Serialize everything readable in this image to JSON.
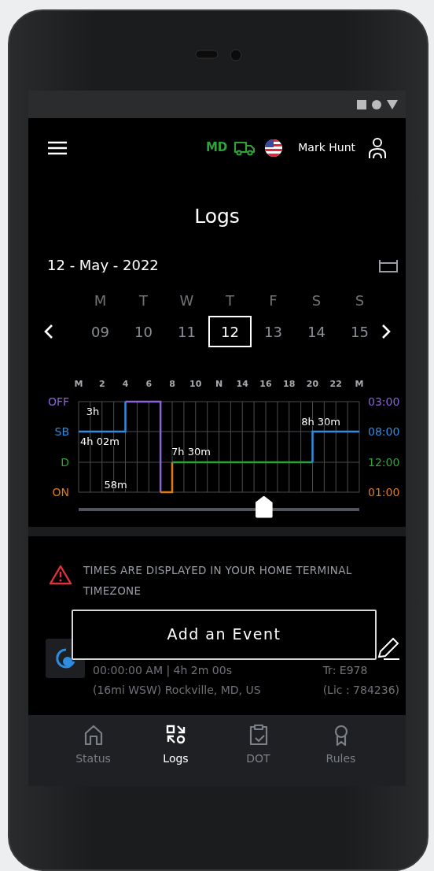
{
  "header": {
    "state": "MD",
    "user": "Mark Hunt"
  },
  "title": "Logs",
  "date": "12 - May - 2022",
  "week": [
    {
      "weekday": "M",
      "day": "09",
      "selected": false
    },
    {
      "weekday": "T",
      "day": "10",
      "selected": false
    },
    {
      "weekday": "W",
      "day": "11",
      "selected": false
    },
    {
      "weekday": "T",
      "day": "12",
      "selected": true
    },
    {
      "weekday": "F",
      "day": "13",
      "selected": false
    },
    {
      "weekday": "S",
      "day": "14",
      "selected": false
    },
    {
      "weekday": "S",
      "day": "15",
      "selected": false
    }
  ],
  "graph": {
    "hours": [
      "M",
      "2",
      "4",
      "6",
      "8",
      "10",
      "N",
      "14",
      "16",
      "18",
      "20",
      "22",
      "M"
    ],
    "rows": [
      {
        "label": "OFF",
        "total": "03:00",
        "color": "#8a63d8"
      },
      {
        "label": "SB",
        "total": "08:00",
        "color": "#2f8de0"
      },
      {
        "label": "D",
        "total": "12:00",
        "color": "#2ea339"
      },
      {
        "label": "ON",
        "total": "01:00",
        "color": "#e07a16"
      }
    ],
    "durations": [
      "3h",
      "4h 02m",
      "8h 30m",
      "7h 30m",
      "58m"
    ],
    "slider": {
      "level": 0.66
    }
  },
  "notice": "TIMES ARE DISPLAYED IN YOUR HOME TERMINAL TIMEZONE",
  "event": {
    "time": "00:00:00 AM | 4h 2m 00s",
    "location": "(16mi WSW) Rockville, MD, US",
    "trailer": "Tr: E978",
    "license": "(Lic : 784236)"
  },
  "add_button": "Add an Event",
  "nav": [
    {
      "label": "Status",
      "selected": false
    },
    {
      "label": "Logs",
      "selected": true
    },
    {
      "label": "DOT",
      "selected": false
    },
    {
      "label": "Rules",
      "selected": false
    }
  ]
}
